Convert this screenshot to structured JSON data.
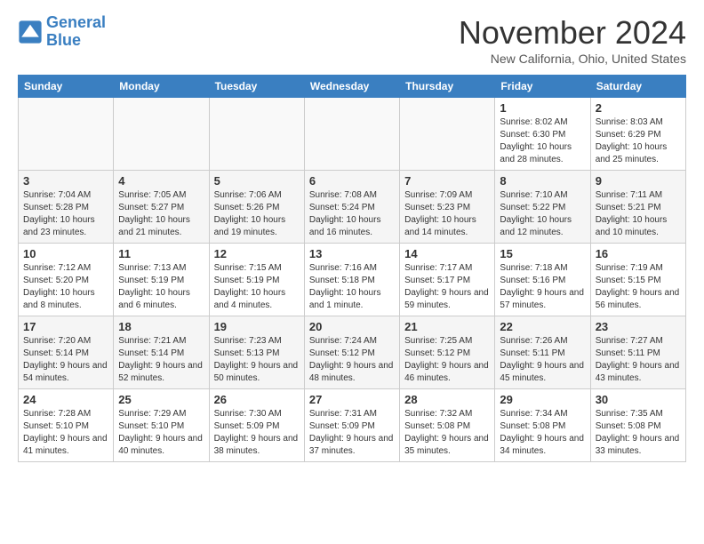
{
  "header": {
    "logo_line1": "General",
    "logo_line2": "Blue",
    "month": "November 2024",
    "location": "New California, Ohio, United States"
  },
  "weekdays": [
    "Sunday",
    "Monday",
    "Tuesday",
    "Wednesday",
    "Thursday",
    "Friday",
    "Saturday"
  ],
  "weeks": [
    [
      {
        "day": "",
        "info": ""
      },
      {
        "day": "",
        "info": ""
      },
      {
        "day": "",
        "info": ""
      },
      {
        "day": "",
        "info": ""
      },
      {
        "day": "",
        "info": ""
      },
      {
        "day": "1",
        "info": "Sunrise: 8:02 AM\nSunset: 6:30 PM\nDaylight: 10 hours and 28 minutes."
      },
      {
        "day": "2",
        "info": "Sunrise: 8:03 AM\nSunset: 6:29 PM\nDaylight: 10 hours and 25 minutes."
      }
    ],
    [
      {
        "day": "3",
        "info": "Sunrise: 7:04 AM\nSunset: 5:28 PM\nDaylight: 10 hours and 23 minutes."
      },
      {
        "day": "4",
        "info": "Sunrise: 7:05 AM\nSunset: 5:27 PM\nDaylight: 10 hours and 21 minutes."
      },
      {
        "day": "5",
        "info": "Sunrise: 7:06 AM\nSunset: 5:26 PM\nDaylight: 10 hours and 19 minutes."
      },
      {
        "day": "6",
        "info": "Sunrise: 7:08 AM\nSunset: 5:24 PM\nDaylight: 10 hours and 16 minutes."
      },
      {
        "day": "7",
        "info": "Sunrise: 7:09 AM\nSunset: 5:23 PM\nDaylight: 10 hours and 14 minutes."
      },
      {
        "day": "8",
        "info": "Sunrise: 7:10 AM\nSunset: 5:22 PM\nDaylight: 10 hours and 12 minutes."
      },
      {
        "day": "9",
        "info": "Sunrise: 7:11 AM\nSunset: 5:21 PM\nDaylight: 10 hours and 10 minutes."
      }
    ],
    [
      {
        "day": "10",
        "info": "Sunrise: 7:12 AM\nSunset: 5:20 PM\nDaylight: 10 hours and 8 minutes."
      },
      {
        "day": "11",
        "info": "Sunrise: 7:13 AM\nSunset: 5:19 PM\nDaylight: 10 hours and 6 minutes."
      },
      {
        "day": "12",
        "info": "Sunrise: 7:15 AM\nSunset: 5:19 PM\nDaylight: 10 hours and 4 minutes."
      },
      {
        "day": "13",
        "info": "Sunrise: 7:16 AM\nSunset: 5:18 PM\nDaylight: 10 hours and 1 minute."
      },
      {
        "day": "14",
        "info": "Sunrise: 7:17 AM\nSunset: 5:17 PM\nDaylight: 9 hours and 59 minutes."
      },
      {
        "day": "15",
        "info": "Sunrise: 7:18 AM\nSunset: 5:16 PM\nDaylight: 9 hours and 57 minutes."
      },
      {
        "day": "16",
        "info": "Sunrise: 7:19 AM\nSunset: 5:15 PM\nDaylight: 9 hours and 56 minutes."
      }
    ],
    [
      {
        "day": "17",
        "info": "Sunrise: 7:20 AM\nSunset: 5:14 PM\nDaylight: 9 hours and 54 minutes."
      },
      {
        "day": "18",
        "info": "Sunrise: 7:21 AM\nSunset: 5:14 PM\nDaylight: 9 hours and 52 minutes."
      },
      {
        "day": "19",
        "info": "Sunrise: 7:23 AM\nSunset: 5:13 PM\nDaylight: 9 hours and 50 minutes."
      },
      {
        "day": "20",
        "info": "Sunrise: 7:24 AM\nSunset: 5:12 PM\nDaylight: 9 hours and 48 minutes."
      },
      {
        "day": "21",
        "info": "Sunrise: 7:25 AM\nSunset: 5:12 PM\nDaylight: 9 hours and 46 minutes."
      },
      {
        "day": "22",
        "info": "Sunrise: 7:26 AM\nSunset: 5:11 PM\nDaylight: 9 hours and 45 minutes."
      },
      {
        "day": "23",
        "info": "Sunrise: 7:27 AM\nSunset: 5:11 PM\nDaylight: 9 hours and 43 minutes."
      }
    ],
    [
      {
        "day": "24",
        "info": "Sunrise: 7:28 AM\nSunset: 5:10 PM\nDaylight: 9 hours and 41 minutes."
      },
      {
        "day": "25",
        "info": "Sunrise: 7:29 AM\nSunset: 5:10 PM\nDaylight: 9 hours and 40 minutes."
      },
      {
        "day": "26",
        "info": "Sunrise: 7:30 AM\nSunset: 5:09 PM\nDaylight: 9 hours and 38 minutes."
      },
      {
        "day": "27",
        "info": "Sunrise: 7:31 AM\nSunset: 5:09 PM\nDaylight: 9 hours and 37 minutes."
      },
      {
        "day": "28",
        "info": "Sunrise: 7:32 AM\nSunset: 5:08 PM\nDaylight: 9 hours and 35 minutes."
      },
      {
        "day": "29",
        "info": "Sunrise: 7:34 AM\nSunset: 5:08 PM\nDaylight: 9 hours and 34 minutes."
      },
      {
        "day": "30",
        "info": "Sunrise: 7:35 AM\nSunset: 5:08 PM\nDaylight: 9 hours and 33 minutes."
      }
    ]
  ]
}
